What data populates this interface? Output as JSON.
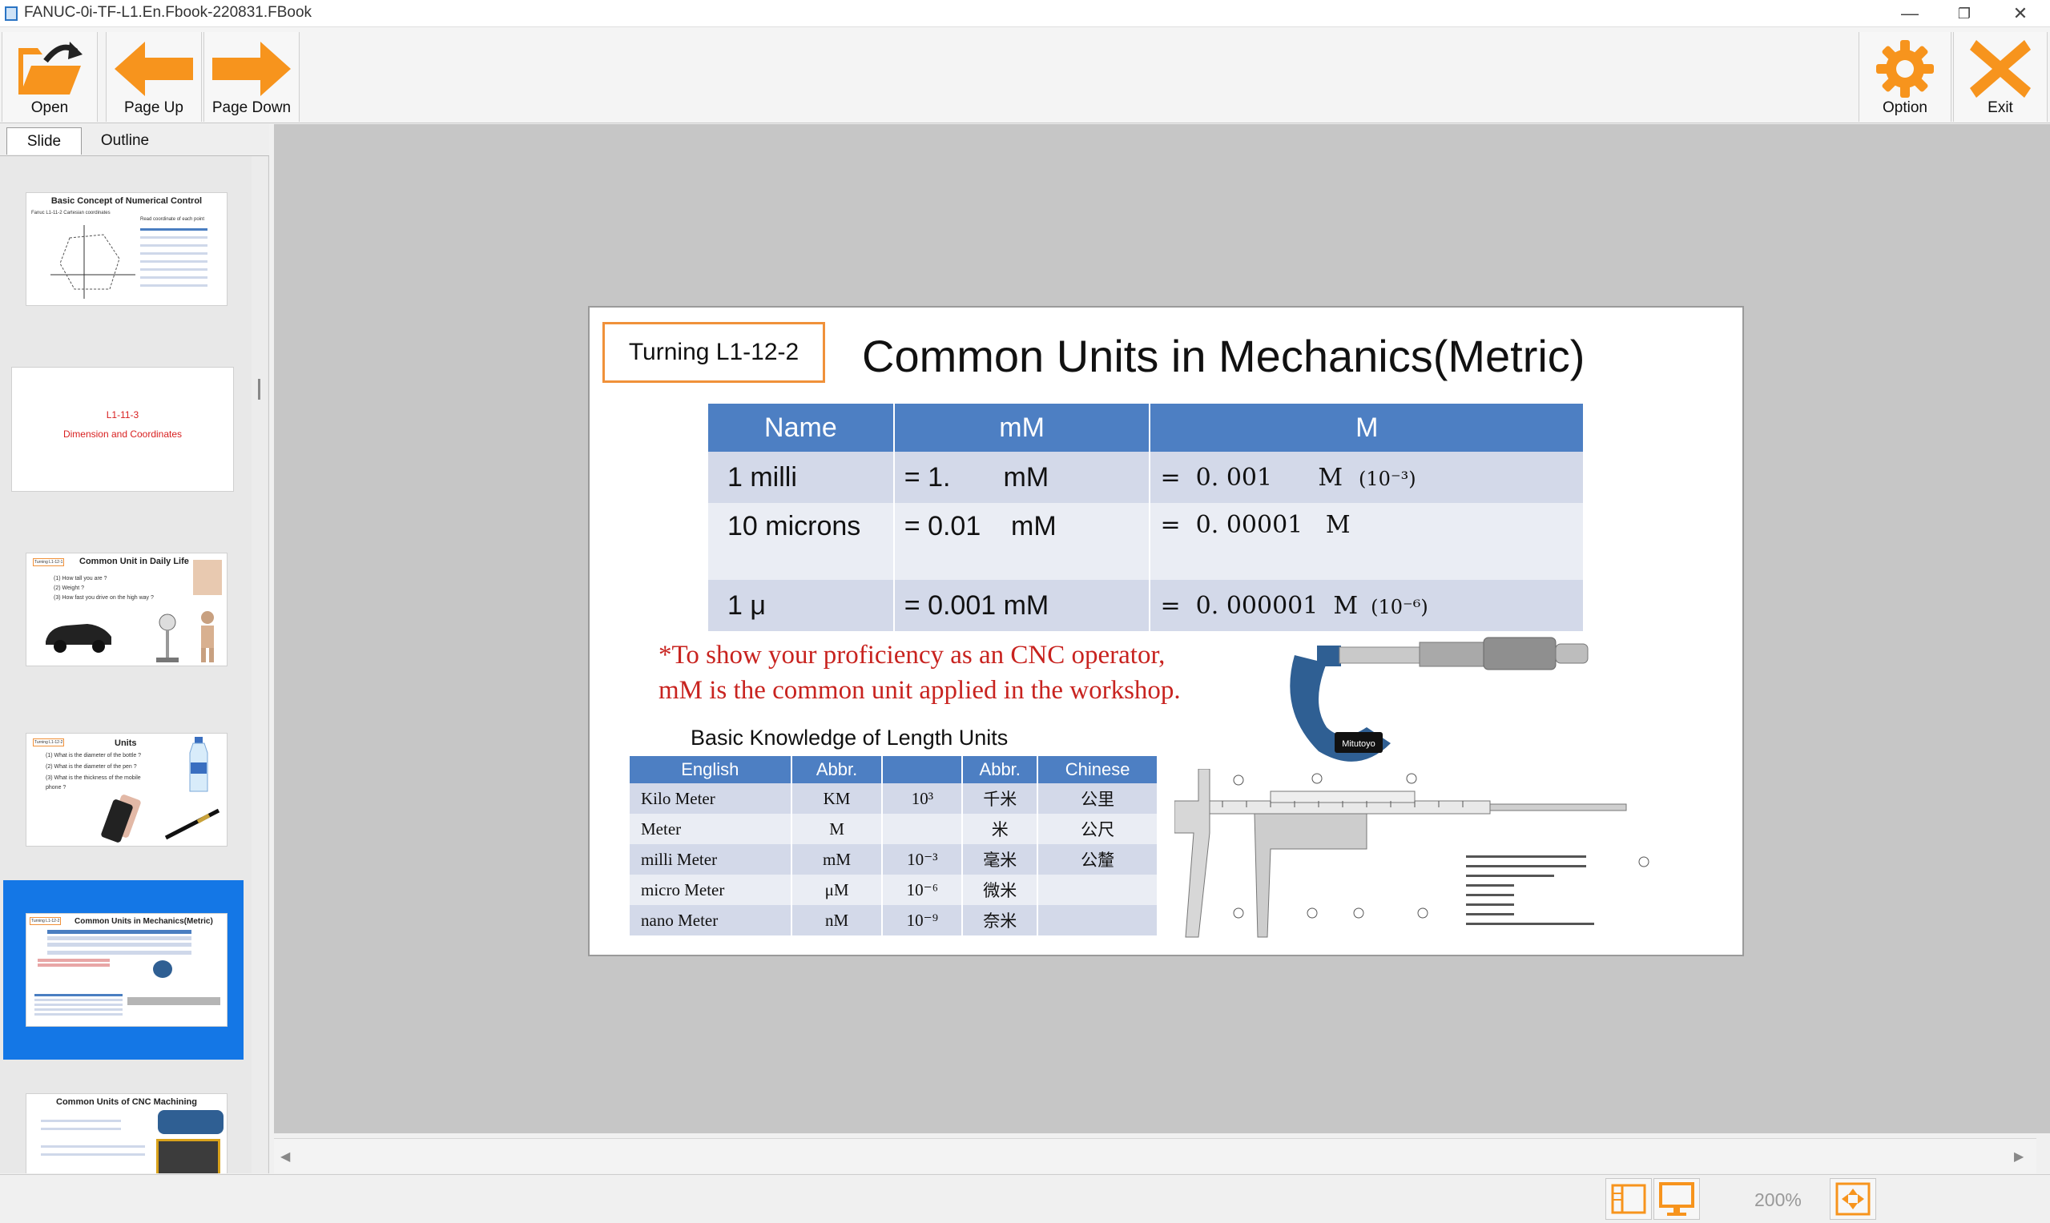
{
  "window": {
    "title": "FANUC-0i-TF-L1.En.Fbook-220831.FBook",
    "minimize_glyph": "—",
    "maximize_glyph": "❐",
    "close_glyph": "✕"
  },
  "toolbar": {
    "open_label": "Open",
    "page_up_label": "Page Up",
    "page_down_label": "Page Down",
    "option_label": "Option",
    "exit_label": "Exit",
    "accent_color": "#f7941d"
  },
  "panel": {
    "tabs": [
      {
        "label": "Slide",
        "active": true
      },
      {
        "label": "Outline",
        "active": false
      }
    ]
  },
  "thumbnails": [
    {
      "title": "Basic Concept of Numerical Control",
      "subtitle": "Fanuc L1-11-2 Cartesian coordinates",
      "extra": "Read coordinate of each point"
    },
    {
      "line1": "L1-11-3",
      "line2": "Dimension and Coordinates"
    },
    {
      "tag": "Turning L1-12-1",
      "title": "Common Unit in Daily Life",
      "items": [
        "(1) How tall you are ?",
        "(2) Weight ?",
        "(3) How fast you drive on the high way ?"
      ]
    },
    {
      "tag": "Turning L1-12-2",
      "title": "Units",
      "items": [
        "(1) What is the diameter of the bottle ?",
        "(2) What is the diameter of the pen ?",
        "(3) What is the thickness of the mobile",
        "phone ?"
      ]
    },
    {
      "tag": "Turning L1-12-2",
      "title": "Common Units in Mechanics(Metric)"
    },
    {
      "title": "Common Units of CNC Machining"
    }
  ],
  "slide": {
    "tag": "Turning  L1-12-2",
    "title": "Common Units in Mechanics(Metric)",
    "table_headers": [
      "Name",
      "mM",
      "M"
    ],
    "rows": [
      {
        "name": "1 milli",
        "mm": "= 1.       mM",
        "m": "=  0. 001      M",
        "exp": "(10⁻³)"
      },
      {
        "name": "10 microns",
        "mm": "= 0.01    mM",
        "m": "=  0. 00001   M",
        "exp": ""
      },
      {
        "name": "1 μ",
        "mm": "= 0.001 mM",
        "m": "=  0. 000001  M",
        "exp": "(10⁻⁶)"
      }
    ],
    "note_line1": "*To show your proficiency as an CNC operator,",
    "note_line2": "mM is the common unit applied in the workshop.",
    "knowledge_title": "Basic Knowledge of Length Units",
    "knowledge_headers": [
      "English",
      "Abbr.",
      "",
      "Abbr.",
      "Chinese"
    ],
    "knowledge_rows": [
      [
        "Kilo Meter",
        "KM",
        "10³",
        "千米",
        "公里"
      ],
      [
        "Meter",
        "M",
        "",
        "米",
        "公尺"
      ],
      [
        "milli Meter",
        "mM",
        "10⁻³",
        "毫米",
        "公釐"
      ],
      [
        "micro Meter",
        "μM",
        "10⁻⁶",
        "微米",
        ""
      ],
      [
        "nano Meter",
        "nM",
        "10⁻⁹",
        "奈米",
        ""
      ]
    ],
    "micrometer_brand": "Mitutoyo"
  },
  "status": {
    "zoom": "200%"
  }
}
